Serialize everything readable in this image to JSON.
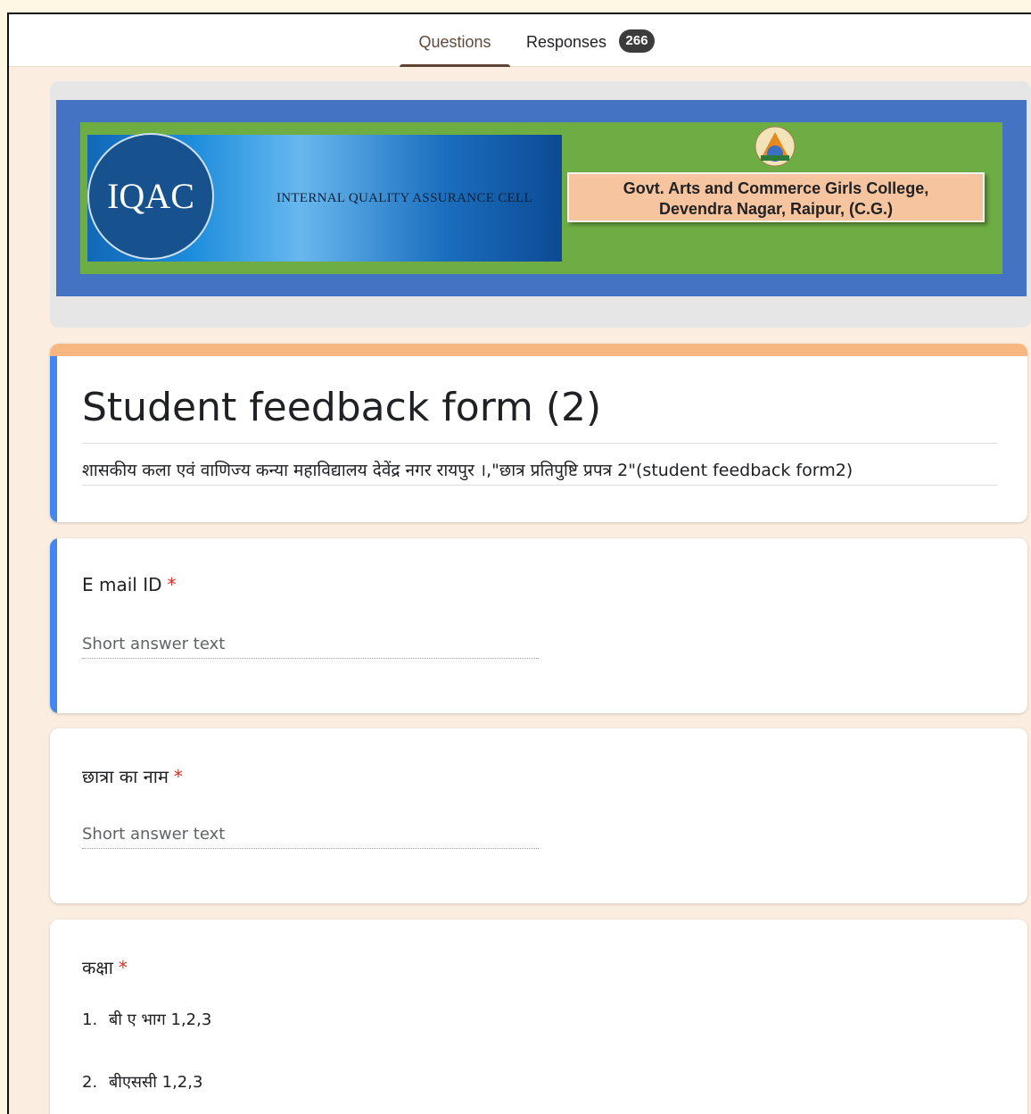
{
  "tabs": {
    "questions": "Questions",
    "responses": "Responses",
    "responses_count": "266"
  },
  "banner": {
    "iqac_logo": "IQAC",
    "iqac_subtitle": "INTERNAL QUALITY ASSURANCE CELL",
    "college_line1": "Govt. Arts and Commerce Girls College,",
    "college_line2": "Devendra Nagar, Raipur, (C.G.)"
  },
  "form": {
    "title": "Student feedback form (2)",
    "description": "शासकीय कला एवं वाणिज्य कन्या महाविद्यालय देवेंद्र नगर रायपुर ।,\"छात्र प्रतिपुष्टि प्रपत्र 2\"(student feedback form2)"
  },
  "questions": [
    {
      "label": "E mail ID",
      "required_mark": "*",
      "placeholder": "Short answer text"
    },
    {
      "label": "छात्रा का नाम",
      "required_mark": "*",
      "placeholder": "Short answer text"
    },
    {
      "label": "कक्षा",
      "required_mark": "*",
      "options": [
        {
          "num": "1.",
          "text": "बी ए भाग 1,2,3"
        },
        {
          "num": "2.",
          "text": "बीएससी 1,2,3"
        }
      ]
    }
  ],
  "colors": {
    "accent_orange": "#f8b680",
    "accent_blue": "#4285f4",
    "required_red": "#d93025",
    "background": "#fbeee0"
  }
}
